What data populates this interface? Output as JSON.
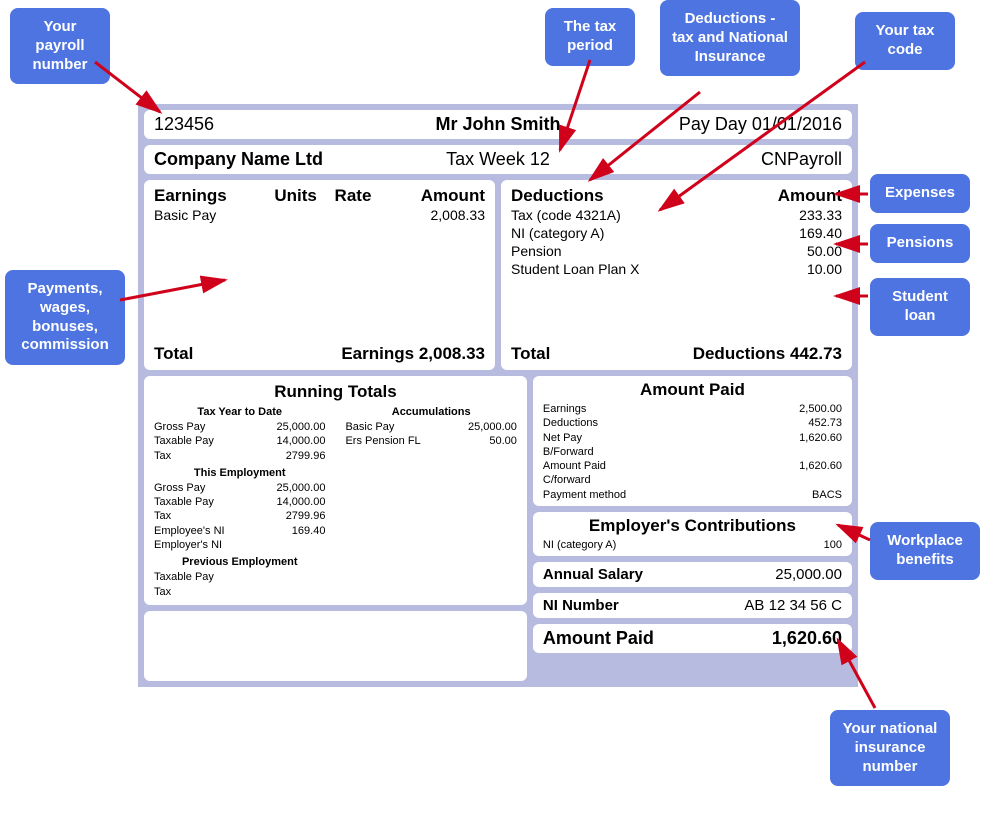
{
  "callouts": {
    "payroll_number": "Your payroll number",
    "tax_period": "The tax period",
    "deductions": "Deductions - tax and National Insurance",
    "tax_code": "Your tax code",
    "expenses": "Expenses",
    "pensions": "Pensions",
    "student_loan": "Student loan",
    "payments": "Payments, wages, bonuses, commission",
    "workplace_benefits": "Workplace benefits",
    "ni_number": "Your national insurance number"
  },
  "header": {
    "payroll_number": "123456",
    "employee_name": "Mr John Smith",
    "pay_day": "Pay Day 01/01/2016",
    "company": "Company Name Ltd",
    "tax_week": "Tax Week 12",
    "software": "CNPayroll"
  },
  "earnings": {
    "heading": {
      "name": "Earnings",
      "units": "Units",
      "rate": "Rate",
      "amount": "Amount"
    },
    "lines": [
      {
        "label": "Basic Pay",
        "amount": "2,008.33"
      }
    ],
    "total": {
      "label": "Total",
      "value_label": "Earnings",
      "value": "2,008.33"
    }
  },
  "deductions": {
    "heading": {
      "name": "Deductions",
      "amount": "Amount"
    },
    "lines": [
      {
        "label": "Tax (code 4321A)",
        "amount": "233.33"
      },
      {
        "label": "NI (category A)",
        "amount": "169.40"
      },
      {
        "label": "Pension",
        "amount": "50.00"
      },
      {
        "label": "Student Loan Plan X",
        "amount": "10.00"
      }
    ],
    "total": {
      "label": "Total",
      "value_label": "Deductions",
      "value": "442.73"
    }
  },
  "running_totals": {
    "title": "Running Totals",
    "ytd_title": "Tax Year to Date",
    "ytd": [
      {
        "label": "Gross Pay",
        "value": "25,000.00"
      },
      {
        "label": "Taxable Pay",
        "value": "14,000.00"
      },
      {
        "label": "Tax",
        "value": "2799.96"
      }
    ],
    "this_emp_title": "This Employment",
    "this_emp": [
      {
        "label": "Gross Pay",
        "value": "25,000.00"
      },
      {
        "label": "Taxable Pay",
        "value": "14,000.00"
      },
      {
        "label": "Tax",
        "value": "2799.96"
      },
      {
        "label": "Employee's NI",
        "value": "169.40"
      },
      {
        "label": "Employer's NI",
        "value": ""
      }
    ],
    "prev_emp_title": "Previous Employment",
    "prev_emp": [
      {
        "label": "Taxable Pay",
        "value": ""
      },
      {
        "label": "Tax",
        "value": ""
      }
    ],
    "accum_title": "Accumulations",
    "accum": [
      {
        "label": "Basic Pay",
        "value": "25,000.00"
      },
      {
        "label": "Ers Pension FL",
        "value": "50.00"
      }
    ]
  },
  "amount_paid": {
    "title": "Amount Paid",
    "items": [
      {
        "label": "Earnings",
        "value": "2,500.00"
      },
      {
        "label": "Deductions",
        "value": "452.73"
      },
      {
        "label": "Net Pay",
        "value": "1,620.60"
      },
      {
        "label": "B/Forward",
        "value": ""
      },
      {
        "label": "",
        "value": ""
      },
      {
        "label": "Amount Paid",
        "value": "1,620.60"
      },
      {
        "label": "C/forward",
        "value": ""
      },
      {
        "label": "Payment method",
        "value": "BACS"
      }
    ]
  },
  "employer_contrib": {
    "title": "Employer's Contributions",
    "items": [
      {
        "label": "NI (category A)",
        "value": "100"
      }
    ]
  },
  "annual_salary": {
    "label": "Annual Salary",
    "value": "25,000.00"
  },
  "ni_number": {
    "label": "NI Number",
    "value": "AB 12 34 56 C"
  },
  "final": {
    "label": "Amount Paid",
    "value": "1,620.60"
  }
}
